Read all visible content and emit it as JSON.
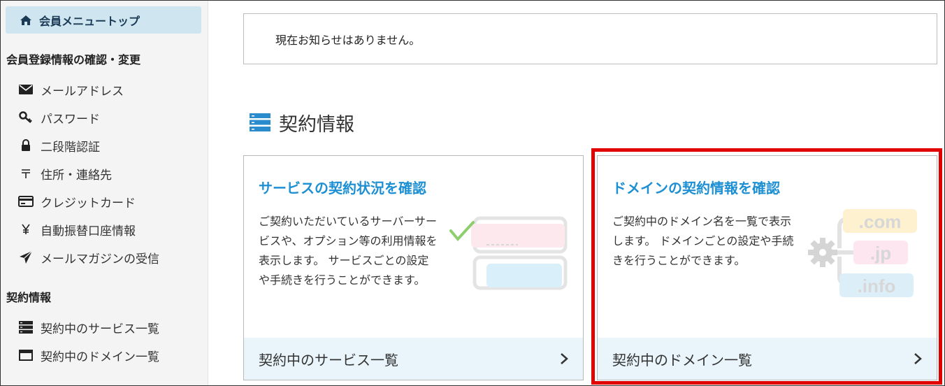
{
  "sidebar": {
    "top_item": {
      "label": "会員メニュートップ",
      "icon": "home-icon"
    },
    "section1": {
      "heading": "会員登録情報の確認・変更",
      "items": [
        {
          "label": "メールアドレス",
          "icon": "envelope-icon"
        },
        {
          "label": "パスワード",
          "icon": "key-icon"
        },
        {
          "label": "二段階認証",
          "icon": "lock-icon"
        },
        {
          "label": "住所・連絡先",
          "icon": "postal-mark-icon"
        },
        {
          "label": "クレジットカード",
          "icon": "credit-card-icon"
        },
        {
          "label": "自動振替口座情報",
          "icon": "yen-icon"
        },
        {
          "label": "メールマガジンの受信",
          "icon": "paper-plane-icon"
        }
      ]
    },
    "section2": {
      "heading": "契約情報",
      "items": [
        {
          "label": "契約中のサービス一覧",
          "icon": "server-icon"
        },
        {
          "label": "契約中のドメイン一覧",
          "icon": "window-icon"
        }
      ]
    }
  },
  "notice": {
    "text": "現在お知らせはありません。"
  },
  "contract": {
    "heading": "契約情報",
    "cards": [
      {
        "title": "サービスの契約状況を確認",
        "description": "ご契約いただいているサーバーサービスや、オプション等の利用情報を表示します。 サービスごとの設定や手続きを行うことができます。",
        "footer": "契約中のサービス一覧"
      },
      {
        "title": "ドメインの契約情報を確認",
        "description": "ご契約中のドメイン名を一覧で表示します。 ドメインごとの設定や手続きを行うことができます。",
        "footer": "契約中のドメイン一覧",
        "tlds": [
          ".com",
          ".jp",
          ".info"
        ]
      }
    ]
  },
  "colors": {
    "accent": "#1d8fd3",
    "highlight": "#e00000",
    "nav_active_bg": "#cfe6f1",
    "card_footer_bg": "#e9f5fb"
  }
}
